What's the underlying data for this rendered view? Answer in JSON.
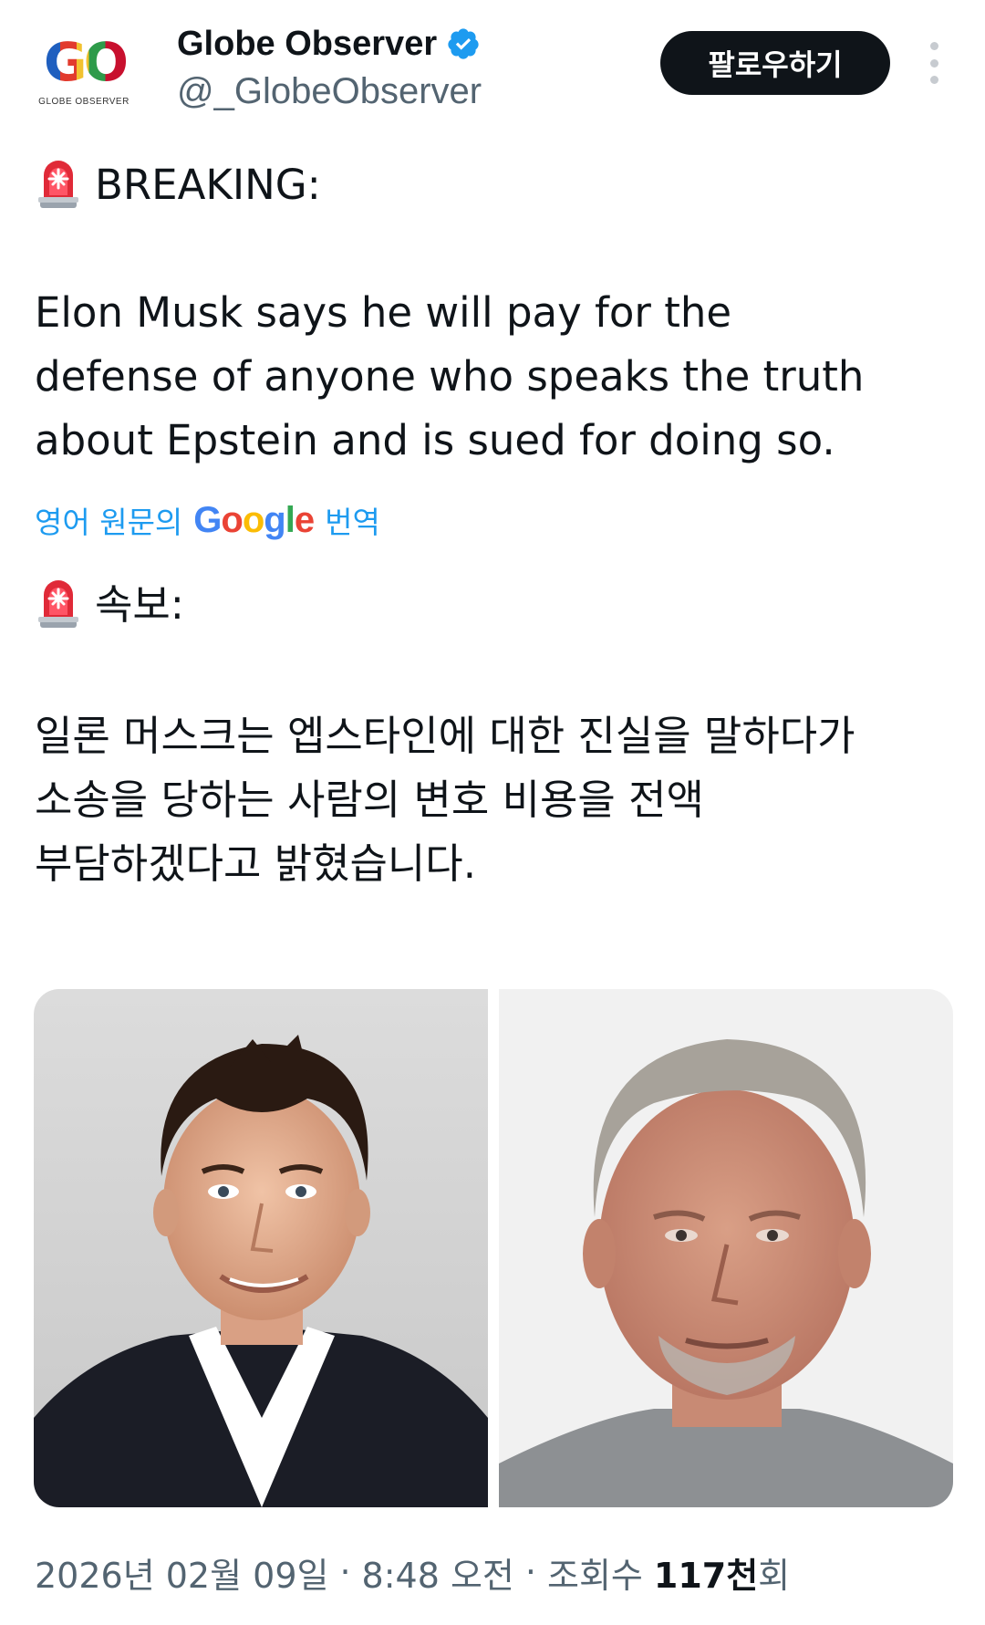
{
  "account": {
    "display_name": "Globe Observer",
    "handle": "@_GlobeObserver",
    "verified": true,
    "avatar_logo_text": "GO",
    "avatar_subtitle": "GLOBE OBSERVER"
  },
  "header": {
    "follow_label": "팔로우하기",
    "more_icon": "more-vertical-icon"
  },
  "tweet": {
    "emoji_icon": "police-siren-icon",
    "breaking_label": "BREAKING:",
    "english_lines": [
      "Elon Musk says he will pay for the",
      "defense of anyone who speaks the truth",
      "about Epstein and is sued for doing so."
    ],
    "translate_prefix": "영어 원문의",
    "translate_brand": "Google",
    "translate_suffix": "번역",
    "breaking_label_ko": "속보:",
    "korean_lines": [
      "일론 머스크는 엡스타인에 대한 진실을 말하다가",
      "소송을 당하는 사람의 변호 비용을 전액",
      "부담하겠다고 밝혔습니다."
    ]
  },
  "media": {
    "left_photo": "elon-musk-portrait",
    "right_photo": "jeffrey-epstein-portrait"
  },
  "footer": {
    "date": "2026년 02월 09일",
    "separator": "·",
    "time": "8:48 오전",
    "views_label": "조회수",
    "views_count": "117천",
    "views_unit": "회"
  },
  "colors": {
    "accent": "#1d9bf0",
    "follow_bg": "#0f1419",
    "muted": "#536471"
  }
}
